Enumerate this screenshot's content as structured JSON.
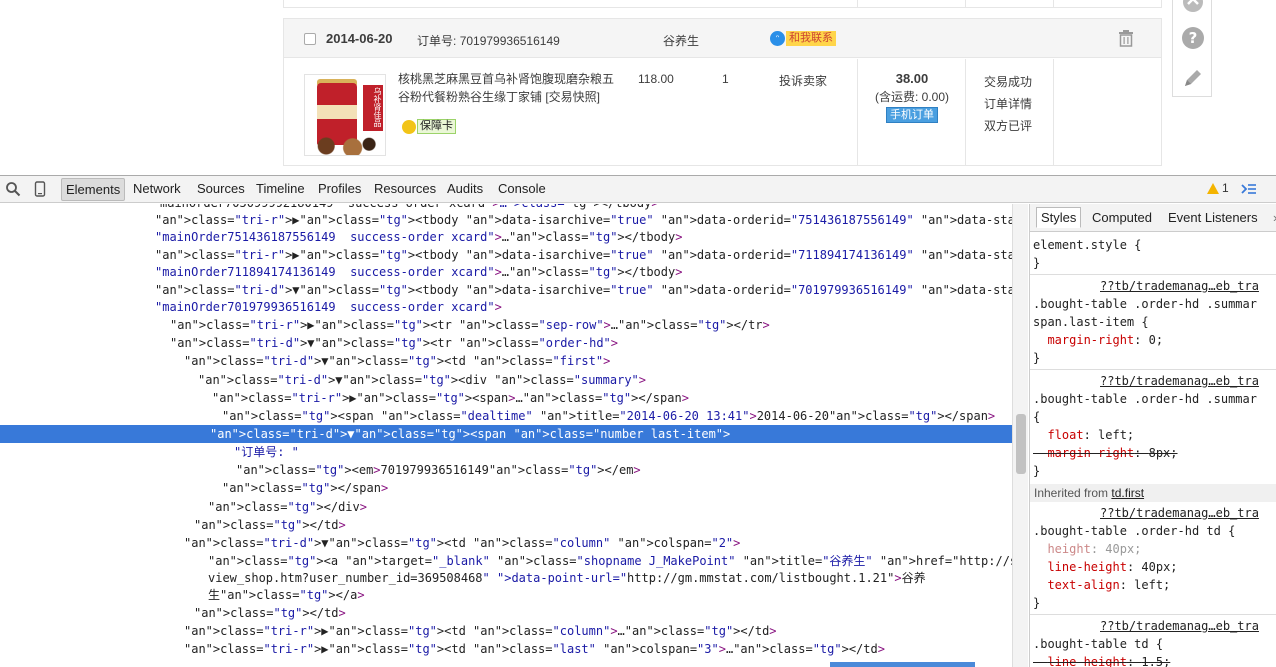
{
  "order": {
    "date": "2014-06-20",
    "order_no_label": "订单号:",
    "order_no": "701979936516149",
    "shop_name": "谷养生",
    "chat_label": "和我联系",
    "product_title": "核桃黑芝麻黑豆首乌补肾饱腹现磨杂粮五谷粉代餐粉熟谷生缘丁家铺 [交易快照]",
    "guarantee_label": "保障卡",
    "unit_price": "118.00",
    "quantity": "1",
    "complain": "投诉卖家",
    "total": "38.00",
    "shipping": "(含运费: 0.00)",
    "mobile_order": "手机订单",
    "status_lines": [
      "交易成功",
      "订单详情",
      "双方已评"
    ],
    "product_image_text": "乌补肾佳品"
  },
  "devtools": {
    "tabs": [
      "Elements",
      "Network",
      "Sources",
      "Timeline",
      "Profiles",
      "Resources",
      "Audits",
      "Console"
    ],
    "active_tab": "Elements",
    "warning_count": "1",
    "dom_lines": [
      {
        "text": "mainOrder705099992180149  success-order xcard\">…</tbody>",
        "indent": 160
      },
      {
        "text": "▶<tbody data-isarchive=\"true\" data-orderid=\"751436187556149\" data-status=\"TRADE_FINISHED\" class=",
        "indent": 155
      },
      {
        "text": "\"mainOrder751436187556149  success-order xcard\">…</tbody>",
        "indent": 155
      },
      {
        "text": "▶<tbody data-isarchive=\"true\" data-orderid=\"711894174136149\" data-status=\"TRADE_FINISHED\" class=",
        "indent": 155
      },
      {
        "text": "\"mainOrder711894174136149  success-order xcard\">…</tbody>",
        "indent": 155
      },
      {
        "text": "▼<tbody data-isarchive=\"true\" data-orderid=\"701979936516149\" data-status=\"TRADE_FINISHED\" class=",
        "indent": 155
      },
      {
        "text": "\"mainOrder701979936516149  success-order xcard\">",
        "indent": 155
      },
      {
        "text": "▶<tr class=\"sep-row\">…</tr>",
        "indent": 170
      },
      {
        "text": "▼<tr class=\"order-hd\">",
        "indent": 170
      },
      {
        "text": "▼<td class=\"first\">",
        "indent": 184
      },
      {
        "text": "▼<div class=\"summary\">",
        "indent": 198
      },
      {
        "text": "▶<span>…</span>",
        "indent": 212
      },
      {
        "text": "<span class=\"dealtime\" title=\"2014-06-20 13:41\">2014-06-20</span>",
        "indent": 222
      },
      {
        "text": "▼<span class=\"number last-item\">",
        "indent": 210,
        "selected": true
      },
      {
        "text": "\"订单号: \"",
        "indent": 234
      },
      {
        "text": "<em>701979936516149</em>",
        "indent": 236
      },
      {
        "text": "</span>",
        "indent": 222
      },
      {
        "text": "</div>",
        "indent": 208
      },
      {
        "text": "</td>",
        "indent": 194
      },
      {
        "text": "▼<td class=\"column\" colspan=\"2\">",
        "indent": 184
      },
      {
        "text": "<a target=\"_blank\" class=\"shopname J_MakePoint\" title=\"谷养生\" href=\"http://store.taobao.com/shop/",
        "indent": 208
      },
      {
        "text": "view_shop.htm?user_number_id=369508468\" data-point-url=\"http://gm.mmstat.com/listbought.1.21\">谷养",
        "indent": 208
      },
      {
        "text": "生</a>",
        "indent": 208
      },
      {
        "text": "</td>",
        "indent": 194
      },
      {
        "text": "▶<td class=\"column\">…</td>",
        "indent": 184
      },
      {
        "text": "▶<td class=\"last\" colspan=\"3\">…</td>",
        "indent": 184
      }
    ],
    "styles_tabs": [
      "Styles",
      "Computed",
      "Event Listeners"
    ],
    "styles_source": "??tb/trademanag…eb_tra",
    "inherited_label": "Inherited from",
    "inherited_from": "td.first",
    "rules": {
      "element_style": "element.style {",
      "rule1_selector_a": ".bought-table .order-hd .summar",
      "rule1_selector_b": "span.last-item {",
      "rule1_prop": "margin-right",
      "rule1_val": "0;",
      "rule2_selector_a": ".bought-table .order-hd .summar",
      "rule2_prop1": "float",
      "rule2_val1": "left;",
      "rule2_prop2": "margin-right",
      "rule2_val2": "8px;",
      "rule3_selector": ".bought-table .order-hd td {",
      "rule3_prop1": "height",
      "rule3_val1": "40px;",
      "rule3_prop2": "line-height",
      "rule3_val2": "40px;",
      "rule3_prop3": "text-align",
      "rule3_val3": "left;",
      "rule4_selector": ".bought-table td {",
      "rule4_prop": "line-height",
      "rule4_val": "1.5;"
    }
  }
}
